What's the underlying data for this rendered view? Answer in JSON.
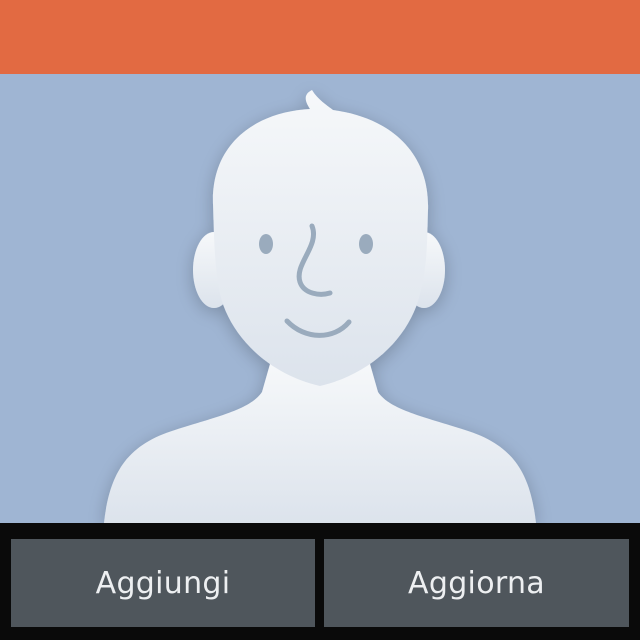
{
  "colors": {
    "header": "#E26A42",
    "photo_background": "#9FB5D3",
    "silhouette_light": "#F6F8FA",
    "silhouette_shade": "#DCE3EC",
    "face_features": "#9AABBD",
    "button_background": "#4F565C",
    "button_text": "#EDEFF1"
  },
  "contact_photo": {
    "icon": "default-avatar-icon"
  },
  "buttons": {
    "add_label": "Aggiungi",
    "update_label": "Aggiorna"
  }
}
